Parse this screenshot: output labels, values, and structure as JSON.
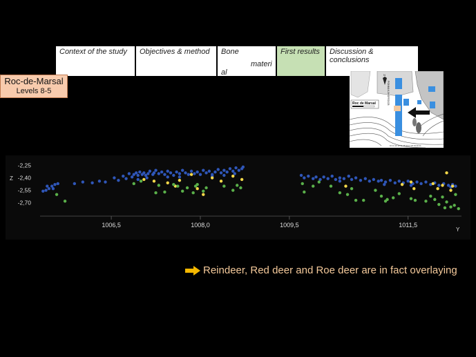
{
  "nav": {
    "tabs": [
      {
        "label": "Context of the study",
        "active": false
      },
      {
        "label": "Objectives  & method",
        "active": false
      },
      {
        "label_lines": [
          "Bone",
          "materi",
          "al"
        ],
        "active": false
      },
      {
        "label": "First results",
        "active": true
      },
      {
        "label": "Discussion & conclusions",
        "active": false
      }
    ]
  },
  "site": {
    "title": "Roc-de-Marsal",
    "subtitle": "Levels 8-5"
  },
  "map": {
    "label": "Roc de Marsal",
    "north": "N",
    "column_letters": "PONMLKJIHGFEDCB",
    "row_numbers": "10 11 12 13 14 15 16 17 18 19 20 21"
  },
  "caption": {
    "text": "Reindeer, Red deer and Roe deer are in fact overlaying",
    "arrow_color": "#f5b800"
  },
  "colors": {
    "blue": "#2f56b8",
    "yellow": "#f5d84a",
    "green": "#5ab04a",
    "nav_active": "#c6e0b4",
    "site_bg": "#f8cbad"
  },
  "chart_data": {
    "type": "scatter",
    "xlabel": "Y",
    "ylabel": "Z",
    "x_ticks": [
      "1006,5",
      "1008,0",
      "1009,5",
      "1011,5"
    ],
    "x_tick_values": [
      1006.5,
      1008.0,
      1009.5,
      1011.5
    ],
    "y_ticks": [
      "-2,25",
      "-2,40",
      "-2,55",
      "-2,70"
    ],
    "y_tick_values": [
      -2.25,
      -2.4,
      -2.55,
      -2.7
    ],
    "xlim": [
      1005.3,
      1012.4
    ],
    "ylim": [
      -2.86,
      -2.18
    ],
    "series": [
      {
        "color": "#2f56b8",
        "points": [
          [
            1005.35,
            -2.56
          ],
          [
            1005.4,
            -2.55
          ],
          [
            1005.45,
            -2.53
          ],
          [
            1005.5,
            -2.5
          ],
          [
            1005.55,
            -2.48
          ],
          [
            1005.52,
            -2.53
          ],
          [
            1005.6,
            -2.47
          ],
          [
            1005.42,
            -2.5
          ],
          [
            1005.88,
            -2.47
          ],
          [
            1006.02,
            -2.45
          ],
          [
            1006.18,
            -2.46
          ],
          [
            1006.3,
            -2.44
          ],
          [
            1006.4,
            -2.45
          ],
          [
            1006.55,
            -2.4
          ],
          [
            1006.62,
            -2.43
          ],
          [
            1006.7,
            -2.38
          ],
          [
            1006.75,
            -2.41
          ],
          [
            1006.8,
            -2.35
          ],
          [
            1006.85,
            -2.39
          ],
          [
            1006.88,
            -2.36
          ],
          [
            1006.92,
            -2.34
          ],
          [
            1006.95,
            -2.37
          ],
          [
            1006.98,
            -2.33
          ],
          [
            1007.02,
            -2.36
          ],
          [
            1007.05,
            -2.34
          ],
          [
            1007.08,
            -2.37
          ],
          [
            1007.12,
            -2.35
          ],
          [
            1007.15,
            -2.32
          ],
          [
            1007.2,
            -2.36
          ],
          [
            1007.22,
            -2.34
          ],
          [
            1007.25,
            -2.31
          ],
          [
            1007.3,
            -2.35
          ],
          [
            1007.35,
            -2.33
          ],
          [
            1007.4,
            -2.36
          ],
          [
            1007.45,
            -2.32
          ],
          [
            1007.5,
            -2.34
          ],
          [
            1007.55,
            -2.37
          ],
          [
            1007.6,
            -2.33
          ],
          [
            1007.65,
            -2.35
          ],
          [
            1007.7,
            -2.31
          ],
          [
            1007.75,
            -2.34
          ],
          [
            1007.8,
            -2.36
          ],
          [
            1007.85,
            -2.32
          ],
          [
            1007.9,
            -2.35
          ],
          [
            1007.95,
            -2.33
          ],
          [
            1008.0,
            -2.36
          ],
          [
            1008.05,
            -2.31
          ],
          [
            1008.1,
            -2.34
          ],
          [
            1008.15,
            -2.32
          ],
          [
            1008.2,
            -2.36
          ],
          [
            1008.25,
            -2.33
          ],
          [
            1008.3,
            -2.3
          ],
          [
            1008.35,
            -2.34
          ],
          [
            1008.4,
            -2.31
          ],
          [
            1008.45,
            -2.33
          ],
          [
            1008.5,
            -2.29
          ],
          [
            1008.55,
            -2.32
          ],
          [
            1008.6,
            -2.28
          ],
          [
            1008.65,
            -2.31
          ],
          [
            1008.7,
            -2.29
          ],
          [
            1008.72,
            -2.27
          ],
          [
            1008.58,
            -2.35
          ],
          [
            1008.4,
            -2.37
          ],
          [
            1008.2,
            -2.38
          ],
          [
            1007.65,
            -2.39
          ],
          [
            1007.1,
            -2.4
          ],
          [
            1006.95,
            -2.42
          ],
          [
            1007.45,
            -2.39
          ],
          [
            1009.7,
            -2.37
          ],
          [
            1009.75,
            -2.4
          ],
          [
            1009.82,
            -2.38
          ],
          [
            1009.9,
            -2.41
          ],
          [
            1009.95,
            -2.39
          ],
          [
            1010.02,
            -2.42
          ],
          [
            1010.08,
            -2.39
          ],
          [
            1010.15,
            -2.41
          ],
          [
            1010.22,
            -2.38
          ],
          [
            1010.28,
            -2.42
          ],
          [
            1010.35,
            -2.4
          ],
          [
            1010.42,
            -2.41
          ],
          [
            1010.5,
            -2.38
          ],
          [
            1010.55,
            -2.42
          ],
          [
            1010.62,
            -2.4
          ],
          [
            1010.7,
            -2.43
          ],
          [
            1010.78,
            -2.41
          ],
          [
            1010.85,
            -2.44
          ],
          [
            1010.92,
            -2.42
          ],
          [
            1011.0,
            -2.44
          ],
          [
            1011.05,
            -2.43
          ],
          [
            1011.12,
            -2.45
          ],
          [
            1011.2,
            -2.43
          ],
          [
            1011.28,
            -2.46
          ],
          [
            1011.35,
            -2.44
          ],
          [
            1011.42,
            -2.46
          ],
          [
            1011.5,
            -2.44
          ],
          [
            1011.58,
            -2.47
          ],
          [
            1011.65,
            -2.45
          ],
          [
            1011.72,
            -2.47
          ],
          [
            1011.8,
            -2.45
          ],
          [
            1011.88,
            -2.48
          ],
          [
            1011.95,
            -2.46
          ],
          [
            1012.02,
            -2.49
          ],
          [
            1012.1,
            -2.47
          ],
          [
            1012.18,
            -2.49
          ],
          [
            1012.25,
            -2.48
          ],
          [
            1012.3,
            -2.5
          ],
          [
            1012.22,
            -2.51
          ],
          [
            1011.1,
            -2.48
          ],
          [
            1010.35,
            -2.44
          ],
          [
            1011.55,
            -2.49
          ]
        ]
      },
      {
        "color": "#f5d84a",
        "points": [
          [
            1007.05,
            -2.42
          ],
          [
            1007.22,
            -2.44
          ],
          [
            1007.45,
            -2.46
          ],
          [
            1007.65,
            -2.43
          ],
          [
            1007.85,
            -2.36
          ],
          [
            1008.05,
            -2.6
          ],
          [
            1008.2,
            -2.4
          ],
          [
            1008.35,
            -2.44
          ],
          [
            1008.55,
            -2.38
          ],
          [
            1008.7,
            -2.42
          ],
          [
            1007.95,
            -2.53
          ],
          [
            1007.58,
            -2.5
          ],
          [
            1010.45,
            -2.5
          ],
          [
            1011.55,
            -2.45
          ],
          [
            1011.6,
            -2.53
          ],
          [
            1011.92,
            -2.47
          ],
          [
            1012.0,
            -2.53
          ],
          [
            1012.08,
            -2.49
          ],
          [
            1012.15,
            -2.34
          ],
          [
            1012.22,
            -2.55
          ],
          [
            1011.4,
            -2.48
          ],
          [
            1012.25,
            -2.5
          ]
        ]
      },
      {
        "color": "#5ab04a",
        "points": [
          [
            1005.58,
            -2.6
          ],
          [
            1005.72,
            -2.68
          ],
          [
            1006.88,
            -2.47
          ],
          [
            1007.0,
            -2.44
          ],
          [
            1007.3,
            -2.49
          ],
          [
            1007.4,
            -2.57
          ],
          [
            1007.55,
            -2.48
          ],
          [
            1007.62,
            -2.5
          ],
          [
            1007.7,
            -2.56
          ],
          [
            1007.78,
            -2.52
          ],
          [
            1007.88,
            -2.58
          ],
          [
            1007.92,
            -2.5
          ],
          [
            1008.05,
            -2.56
          ],
          [
            1008.1,
            -2.52
          ],
          [
            1008.4,
            -2.5
          ],
          [
            1008.55,
            -2.55
          ],
          [
            1008.62,
            -2.49
          ],
          [
            1008.68,
            -2.52
          ],
          [
            1007.25,
            -2.58
          ],
          [
            1007.95,
            -2.48
          ],
          [
            1009.72,
            -2.47
          ],
          [
            1009.75,
            -2.57
          ],
          [
            1009.9,
            -2.5
          ],
          [
            1010.0,
            -2.45
          ],
          [
            1010.2,
            -2.5
          ],
          [
            1010.35,
            -2.58
          ],
          [
            1010.48,
            -2.6
          ],
          [
            1010.55,
            -2.53
          ],
          [
            1010.62,
            -2.67
          ],
          [
            1010.75,
            -2.67
          ],
          [
            1010.95,
            -2.55
          ],
          [
            1011.05,
            -2.62
          ],
          [
            1011.12,
            -2.68
          ],
          [
            1011.25,
            -2.64
          ],
          [
            1011.55,
            -2.65
          ],
          [
            1011.62,
            -2.67
          ],
          [
            1011.8,
            -2.68
          ],
          [
            1011.88,
            -2.62
          ],
          [
            1011.95,
            -2.66
          ],
          [
            1012.02,
            -2.72
          ],
          [
            1012.08,
            -2.63
          ],
          [
            1012.15,
            -2.69
          ],
          [
            1012.22,
            -2.75
          ],
          [
            1012.28,
            -2.73
          ],
          [
            1012.35,
            -2.77
          ],
          [
            1012.12,
            -2.76
          ],
          [
            1011.35,
            -2.59
          ],
          [
            1011.15,
            -2.66
          ],
          [
            1012.3,
            -2.6
          ]
        ]
      }
    ]
  }
}
